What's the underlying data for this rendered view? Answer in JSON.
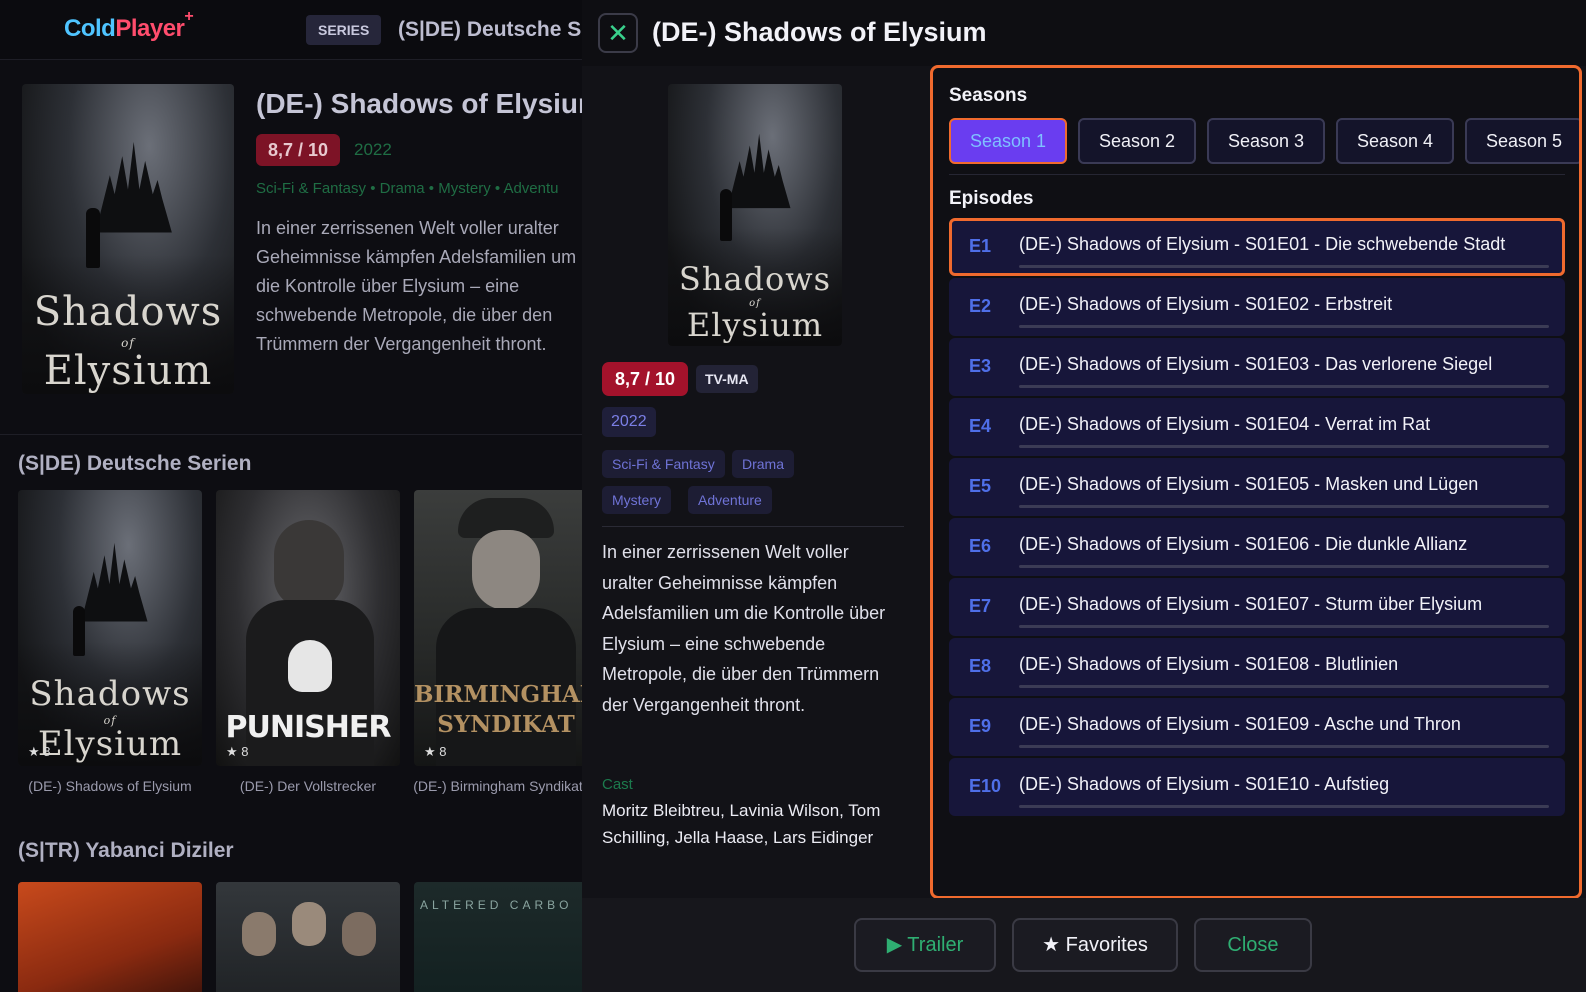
{
  "background": {
    "logo": {
      "part1": "Cold",
      "part2": "Player",
      "plus": "+"
    },
    "category_chip": "SERIES",
    "top_title": "(S|DE) Deutsche Ser",
    "hero": {
      "title": "(DE-) Shadows of Elysium",
      "rating": "8,7 / 10",
      "year": "2022",
      "genres": "Sci-Fi & Fantasy • Drama • Mystery • Adventu",
      "description": "In einer zerrissenen Welt voller uralter Geheimnisse kämpfen Adelsfamilien um die Kontrolle über Elysium – eine schwebende Metropole, die über den Trümmern der Vergangenheit thront."
    },
    "rows": [
      {
        "title": "(S|DE) Deutsche Serien",
        "cards": [
          {
            "label": "(DE-) Shadows of Elysium",
            "rating": "★ 8",
            "art": "shadows-poster"
          },
          {
            "label": "(DE-) Der Vollstrecker",
            "rating": "★ 8",
            "art": "punisher-poster"
          },
          {
            "label": "(DE-) Birmingham Syndikat",
            "rating": "★ 8",
            "art": "birmingham-poster"
          }
        ]
      },
      {
        "title": "(S|TR) Yabanci Diziler"
      }
    ]
  },
  "poster_text": {
    "line1": "Shadows",
    "of": "of",
    "line2": "Elysium"
  },
  "punisher_text": "PUNISHER",
  "birmingham_text": {
    "line1": "BIRMINGHAM",
    "line2": "SYNDIKAT"
  },
  "altered_text": "ALTERED CARBO",
  "modal": {
    "close_icon": "close-icon",
    "title": "(DE-) Shadows of Elysium",
    "rating": "8,7 / 10",
    "age_rating": "TV-MA",
    "year": "2022",
    "genres": [
      "Sci-Fi & Fantasy",
      "Drama",
      "Mystery",
      "Adventure"
    ],
    "description": "In einer zerrissenen Welt voller uralter Geheimnisse kämpfen Adelsfamilien um die Kontrolle über Elysium – eine schwebende Metropole, die über den Trümmern der Vergangenheit thront.",
    "cast_label": "Cast",
    "cast": "Moritz Bleibtreu, Lavinia Wilson, Tom Schilling, Jella Haase, Lars Eidinger",
    "seasons_label": "Seasons",
    "seasons": [
      "Season 1",
      "Season 2",
      "Season 3",
      "Season 4",
      "Season 5"
    ],
    "active_season": 0,
    "episodes_label": "Episodes",
    "episodes": [
      {
        "num": "E1",
        "title": "(DE-) Shadows of Elysium - S01E01 - Die schwebende Stadt"
      },
      {
        "num": "E2",
        "title": "(DE-) Shadows of Elysium - S01E02 - Erbstreit"
      },
      {
        "num": "E3",
        "title": "(DE-) Shadows of Elysium - S01E03 - Das verlorene Siegel"
      },
      {
        "num": "E4",
        "title": "(DE-) Shadows of Elysium - S01E04 - Verrat im Rat"
      },
      {
        "num": "E5",
        "title": "(DE-) Shadows of Elysium - S01E05 - Masken und Lügen"
      },
      {
        "num": "E6",
        "title": "(DE-) Shadows of Elysium - S01E06 - Die dunkle Allianz"
      },
      {
        "num": "E7",
        "title": "(DE-) Shadows of Elysium - S01E07 - Sturm über Elysium"
      },
      {
        "num": "E8",
        "title": "(DE-) Shadows of Elysium - S01E08 - Blutlinien"
      },
      {
        "num": "E9",
        "title": "(DE-) Shadows of Elysium - S01E09 - Asche und Thron"
      },
      {
        "num": "E10",
        "title": "(DE-) Shadows of Elysium - S01E10 - Aufstieg"
      }
    ],
    "active_episode": 0,
    "buttons": {
      "trailer": "▶  Trailer",
      "favorites": "★ Favorites",
      "close": "Close"
    }
  },
  "colors": {
    "accent_orange": "#f06a2e",
    "accent_purple": "#6a3df0",
    "rating_red": "#a3122b",
    "green": "#2fae72"
  }
}
